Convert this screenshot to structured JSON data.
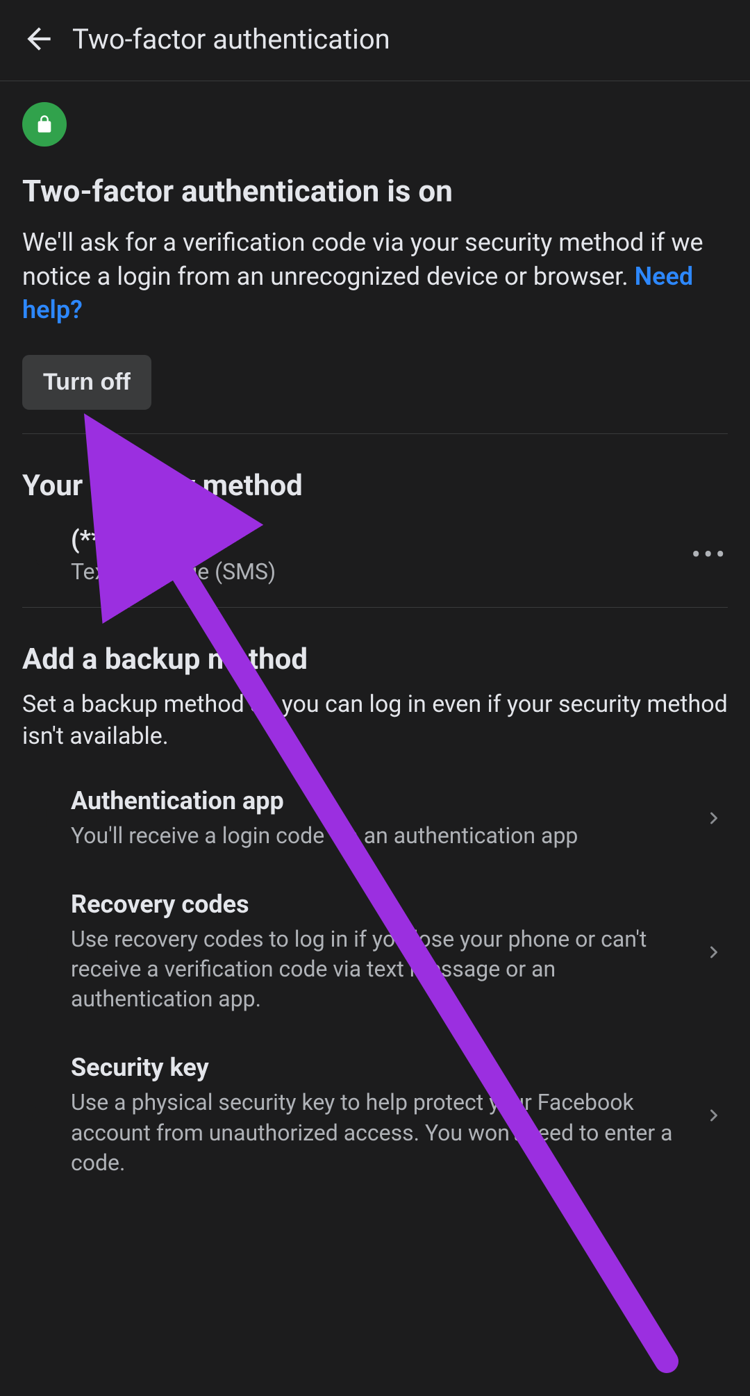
{
  "header": {
    "title": "Two-factor authentication"
  },
  "status": {
    "title": "Two-factor authentication is on",
    "description": "We'll ask for a verification code via your security method if we notice a login from an unrecognized device or browser. ",
    "help_link": "Need help?",
    "turn_off_label": "Turn off"
  },
  "security_method": {
    "section_title": "Your security method",
    "phone_masked": "(***) ***-**15",
    "phone_sub": "Text message (SMS)"
  },
  "backup": {
    "section_title": "Add a backup method",
    "description": "Set a backup method so you can log in even if your security method isn't available.",
    "items": [
      {
        "title": "Authentication app",
        "sub": "You'll receive a login code via an authentication app"
      },
      {
        "title": "Recovery codes",
        "sub": "Use recovery codes to log in if you lose your phone or can't receive a verification code via text message or an authentication app."
      },
      {
        "title": "Security key",
        "sub": "Use a physical security key to help protect your Facebook account from unauthorized access. You won't need to enter a code."
      }
    ]
  }
}
